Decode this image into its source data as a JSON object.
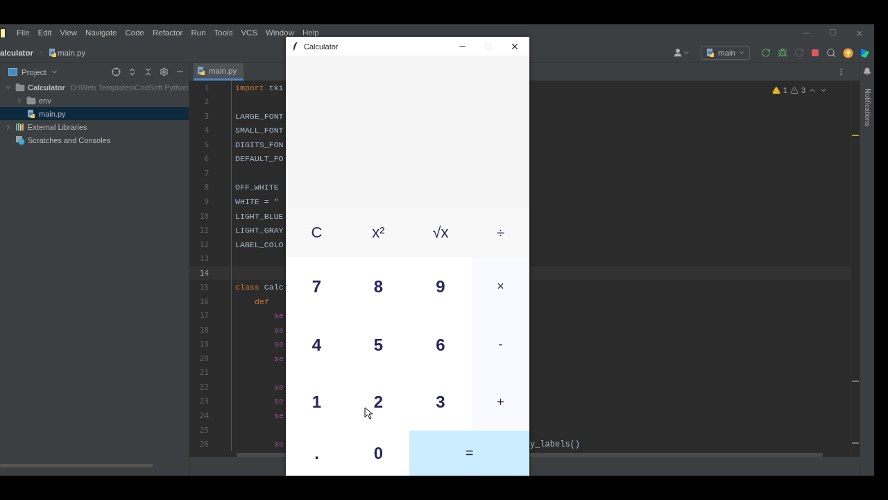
{
  "menu": [
    {
      "label": "File"
    },
    {
      "label": "Edit"
    },
    {
      "label": "View"
    },
    {
      "label": "Navigate"
    },
    {
      "label": "Code"
    },
    {
      "label": "Refactor"
    },
    {
      "label": "Run"
    },
    {
      "label": "Tools"
    },
    {
      "label": "VCS"
    },
    {
      "label": "Window"
    },
    {
      "label": "Help"
    }
  ],
  "breadcrumb": {
    "folder": "alculator",
    "file": "main.py"
  },
  "run_config": "main",
  "project_panel": {
    "title": "Project",
    "tree": [
      {
        "label": "Calculator",
        "path": "D:\\Web Templates\\CodSoft Python",
        "kind": "folder",
        "expanded": true,
        "selected": false,
        "children": [
          {
            "label": "env",
            "kind": "folder",
            "expanded": false,
            "selected": false
          },
          {
            "label": "main.py",
            "kind": "python",
            "selected": true
          }
        ]
      },
      {
        "label": "External Libraries",
        "kind": "library",
        "expanded": false,
        "selected": false
      },
      {
        "label": "Scratches and Consoles",
        "kind": "scratch",
        "selected": false
      }
    ]
  },
  "editor": {
    "tab": "main.py",
    "warnings": "1",
    "weak_warnings": "3",
    "notifications": "Notifications",
    "lines": [
      {
        "number": "1",
        "current": false,
        "kind": "top",
        "tokens": [
          {
            "text": "import",
            "kind": "keyword"
          },
          {
            "text": " tki",
            "kind": "plain"
          }
        ]
      },
      {
        "number": "2",
        "current": false
      },
      {
        "number": "3",
        "current": false,
        "kind": "top",
        "tokens": [
          {
            "text": "LARGE_FONT",
            "kind": "plain"
          }
        ]
      },
      {
        "number": "4",
        "current": false,
        "kind": "top",
        "tokens": [
          {
            "text": "SMALL_FONT",
            "kind": "plain"
          }
        ]
      },
      {
        "number": "5",
        "current": false,
        "kind": "top",
        "tokens": [
          {
            "text": "DIGITS_FON",
            "kind": "plain"
          }
        ]
      },
      {
        "number": "6",
        "current": false,
        "kind": "top",
        "tokens": [
          {
            "text": "DEFAULT_FO",
            "kind": "plain"
          }
        ]
      },
      {
        "number": "7",
        "current": false
      },
      {
        "number": "8",
        "current": false,
        "kind": "top",
        "tokens": [
          {
            "text": "OFF_WHITE",
            "kind": "plain"
          }
        ]
      },
      {
        "number": "9",
        "current": false,
        "kind": "top",
        "tokens": [
          {
            "text": "WHITE = \"",
            "kind": "plain"
          }
        ]
      },
      {
        "number": "10",
        "current": false,
        "kind": "top",
        "tokens": [
          {
            "text": "LIGHT_BLUE",
            "kind": "plain"
          }
        ]
      },
      {
        "number": "11",
        "current": false,
        "kind": "top",
        "tokens": [
          {
            "text": "LIGHT_GRAY",
            "kind": "plain"
          }
        ]
      },
      {
        "number": "12",
        "current": false,
        "kind": "top",
        "tokens": [
          {
            "text": "LABEL_COLO",
            "kind": "plain"
          }
        ]
      },
      {
        "number": "13",
        "current": false
      },
      {
        "number": "14",
        "current": true
      },
      {
        "number": "15",
        "current": false,
        "kind": "top",
        "tokens": [
          {
            "text": "class",
            "kind": "keyword"
          },
          {
            "text": " Calc",
            "kind": "plain"
          }
        ]
      },
      {
        "number": "16",
        "current": false,
        "kind": "member",
        "tokens": [
          {
            "text": "def",
            "kind": "keyword"
          }
        ]
      },
      {
        "number": "17",
        "current": false,
        "kind": "statement",
        "tokens": [
          {
            "text": "se",
            "kind": "self"
          }
        ]
      },
      {
        "number": "18",
        "current": false,
        "kind": "statement",
        "tokens": [
          {
            "text": "se",
            "kind": "self"
          }
        ]
      },
      {
        "number": "19",
        "current": false,
        "kind": "statement",
        "tokens": [
          {
            "text": "se",
            "kind": "self"
          }
        ]
      },
      {
        "number": "20",
        "current": false,
        "kind": "statement",
        "tokens": [
          {
            "text": "se",
            "kind": "self"
          }
        ]
      },
      {
        "number": "21",
        "current": false
      },
      {
        "number": "22",
        "current": false,
        "kind": "statement",
        "tokens": [
          {
            "text": "se",
            "kind": "self"
          }
        ]
      },
      {
        "number": "23",
        "current": false,
        "kind": "statement",
        "tokens": [
          {
            "text": "se",
            "kind": "self"
          }
        ]
      },
      {
        "number": "24",
        "current": false,
        "kind": "statement",
        "tokens": [
          {
            "text": "se",
            "kind": "self"
          }
        ]
      },
      {
        "number": "25",
        "current": false
      },
      {
        "number": "26",
        "current": false,
        "kind": "statement",
        "tokens": [
          {
            "text": "se",
            "kind": "self"
          }
        ],
        "tail": "y_labels()"
      }
    ]
  },
  "calculator": {
    "title": "Calculator",
    "buttons": [
      {
        "label": "C",
        "kind": "special"
      },
      {
        "label": "x²",
        "kind": "special"
      },
      {
        "label": "√x",
        "kind": "special"
      },
      {
        "label": "÷",
        "kind": "special_operator"
      },
      {
        "label": "7",
        "kind": "digit"
      },
      {
        "label": "8",
        "kind": "digit"
      },
      {
        "label": "9",
        "kind": "digit"
      },
      {
        "label": "×",
        "kind": "operator"
      },
      {
        "label": "4",
        "kind": "digit"
      },
      {
        "label": "5",
        "kind": "digit"
      },
      {
        "label": "6",
        "kind": "digit"
      },
      {
        "label": "-",
        "kind": "operator"
      },
      {
        "label": "1",
        "kind": "digit"
      },
      {
        "label": "2",
        "kind": "digit"
      },
      {
        "label": "3",
        "kind": "digit"
      },
      {
        "label": "+",
        "kind": "operator"
      },
      {
        "label": ".",
        "kind": "digit"
      },
      {
        "label": "0",
        "kind": "digit"
      },
      {
        "label": "=",
        "kind": "equals"
      }
    ]
  }
}
